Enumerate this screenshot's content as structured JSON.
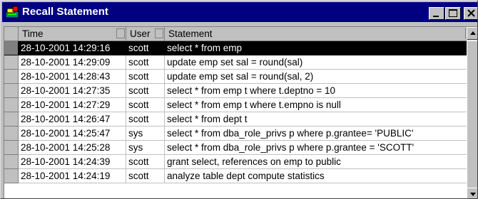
{
  "window": {
    "title": "Recall Statement"
  },
  "columns": {
    "time": "Time",
    "user": "User",
    "statement": "Statement"
  },
  "selected_row": 0,
  "rows": [
    {
      "time": "28-10-2001 14:29:16",
      "user": "scott",
      "statement": "select * from emp"
    },
    {
      "time": "28-10-2001 14:29:09",
      "user": "scott",
      "statement": "update emp set sal = round(sal)"
    },
    {
      "time": "28-10-2001 14:28:43",
      "user": "scott",
      "statement": "update emp set sal = round(sal, 2)"
    },
    {
      "time": "28-10-2001 14:27:35",
      "user": "scott",
      "statement": "select * from emp t where t.deptno = 10"
    },
    {
      "time": "28-10-2001 14:27:29",
      "user": "scott",
      "statement": "select * from emp t where t.empno is null"
    },
    {
      "time": "28-10-2001 14:26:47",
      "user": "scott",
      "statement": "select * from dept t"
    },
    {
      "time": "28-10-2001 14:25:47",
      "user": "sys",
      "statement": "select * from dba_role_privs p where p.grantee= 'PUBLIC'"
    },
    {
      "time": "28-10-2001 14:25:28",
      "user": "sys",
      "statement": "select * from dba_role_privs p where p.grantee = 'SCOTT'"
    },
    {
      "time": "28-10-2001 14:24:39",
      "user": "scott",
      "statement": "grant select, references on emp to public"
    },
    {
      "time": "28-10-2001 14:24:19",
      "user": "scott",
      "statement": "analyze table dept compute statistics"
    }
  ]
}
